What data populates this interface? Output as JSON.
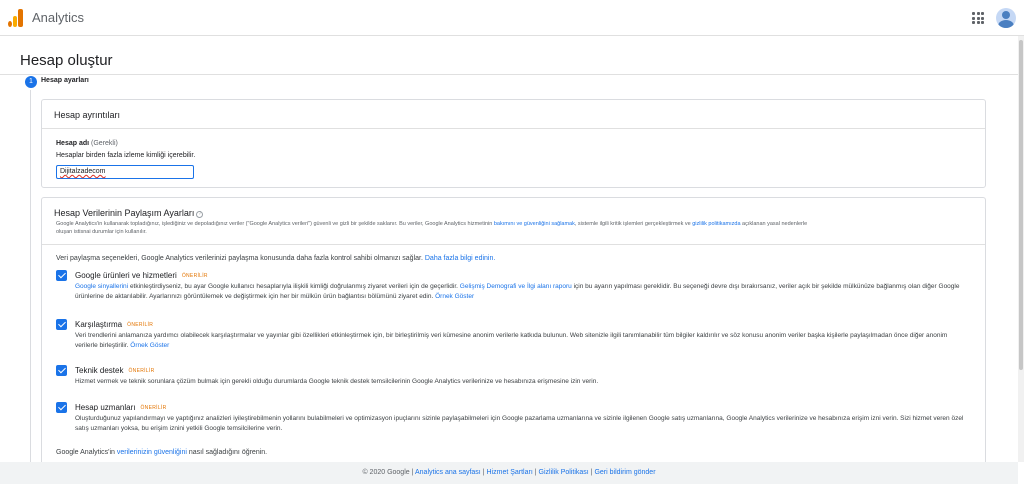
{
  "app": {
    "title": "Analytics",
    "grid_icon": "apps-grid-icon",
    "avatar_icon": "account-avatar-icon",
    "accent": "#1a73e8",
    "badge_color": "#e37400"
  },
  "page": {
    "title": "Hesap oluştur"
  },
  "stepper": {
    "step_number": "1",
    "step_label": "Hesap ayarları"
  },
  "account_details": {
    "header": "Hesap ayrıntıları",
    "name_label": "Hesap adı",
    "name_required": "(Gerekli)",
    "name_hint": "Hesaplar birden fazla izleme kimliği içerebilir.",
    "name_value": "Dijitalzadecom"
  },
  "sharing": {
    "header": "Hesap Verilerinin Paylaşım Ayarları",
    "help_icon": "help-icon",
    "description_1": "Google Analytics'in kullanarak topladığınız, işlediğiniz ve depoladığınız veriler (\"Google Analytics verileri\") güvenli ve gizli bir şekilde saklanır. Bu veriler, Google Analytics hizmetinin",
    "description_link_1": "bakımını ve güvenliğini sağlamak",
    "description_2": ", sistemle ilgili kritik işlemleri gerçekleştirmek ve",
    "description_link_2": "gizlilik politikamızda",
    "description_3": "açıklanan yasal nedenlerle",
    "description_line2": "oluşan istisnai durumlar için kullanılır.",
    "intro": "Veri paylaşma seçenekleri, Google Analytics verilerinizi paylaşma konusunda daha fazla kontrol sahibi olmanızı sağlar.",
    "intro_link": "Daha fazla bilgi edinin.",
    "recommended": "ÖNERİLİR",
    "options": [
      {
        "title": "Google ürünleri ve hizmetleri",
        "checked": true,
        "link_a": "Google sinyallerini",
        "text_a": "etkinleştirdiyseniz, bu ayar Google kullanıcı hesaplarıyla ilişkili kimliği doğrulanmış ziyaret verileri için de geçerlidir.",
        "link_b": "Gelişmiş Demografi ve İlgi alanı raporu",
        "text_b": "için bu ayarın yapılması gereklidir. Bu seçeneği devre dışı bırakırsanız, veriler açık bir",
        "text_c": "şekilde mülkünüze bağlanmış olan diğer Google ürünlerine de aktarılabilir. Ayarlarınızı görüntülemek ve değiştirmek için her bir mülkün ürün bağlantısı bölümünü ziyaret edin.",
        "link_c": "Örnek Göster"
      },
      {
        "title": "Karşılaştırma",
        "checked": true,
        "text_a": "Veri trendlerini anlamanıza yardımcı olabilecek karşılaştırmalar ve yayınlar gibi özellikleri etkinleştirmek için, bir birleştirilmiş veri kümesine anonim verilerle katkıda bulunun. Web sitenizle ilgili tanımlanabilir tüm bilgiler kaldırılır ve söz konusu anonim veriler",
        "text_b": "başka kişilerle paylaşılmadan önce diğer anonim verilerle birleştirilir.",
        "link_a": "Örnek Göster"
      },
      {
        "title": "Teknik destek",
        "checked": true,
        "text_a": "Hizmet vermek ve teknik sorunlara çözüm bulmak için gerekli olduğu durumlarda Google teknik destek temsilcilerinin Google Analytics verilerinize ve hesabınıza erişmesine izin verin."
      },
      {
        "title": "Hesap uzmanları",
        "checked": true,
        "text_a": "Oluşturduğunuz yapılandırmayı ve yaptığınız analizleri iyileştirebilmenin yollarını bulabilmeleri ve optimizasyon ipuçlarını sizinle paylaşabilmeleri için Google pazarlama uzmanlarına ve sizinle ilgilenen Google satış uzmanlarına, Google Analytics verilerinize ve",
        "text_b": "hesabınıza erişim izni verin. Sizi hizmet veren özel satış uzmanları yoksa, bu erişim iznini yetkili Google temsilcilerine verin."
      }
    ],
    "outro_a": "Google Analytics'in",
    "outro_link": "verilerinizin güvenliğini",
    "outro_b": "nasıl sağladığını öğrenin."
  },
  "footer": {
    "copyright": "© 2020 Google",
    "links": [
      "Analytics ana sayfası",
      "Hizmet Şartları",
      "Gizlilik Politikası",
      "Geri bildirim gönder"
    ],
    "sep": "|"
  }
}
